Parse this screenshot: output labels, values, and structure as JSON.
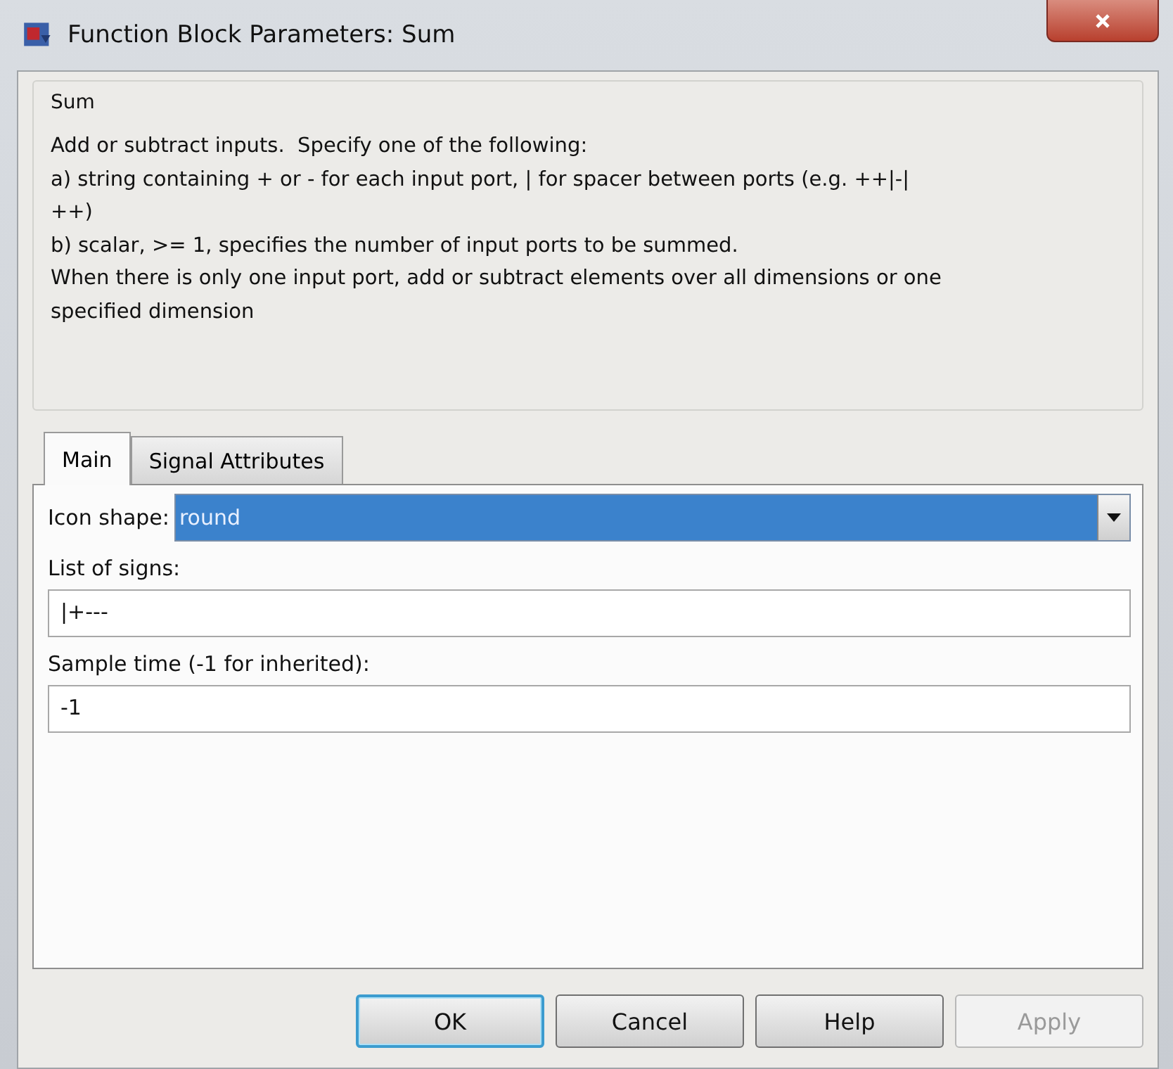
{
  "window": {
    "title": "Function Block Parameters: Sum"
  },
  "group": {
    "title": "Sum",
    "description": [
      "Add or subtract inputs.  Specify one of the following:",
      "a) string containing + or - for each input port, | for spacer between ports (e.g. ++|-|",
      "++)",
      "b) scalar, >= 1, specifies the number of input ports to be summed.",
      "When there is only one input port, add or subtract elements over all dimensions or one",
      "specified dimension"
    ]
  },
  "tabs": [
    {
      "label": "Main",
      "selected": true
    },
    {
      "label": "Signal Attributes",
      "selected": false
    }
  ],
  "params": [
    {
      "kind": "dropdown",
      "label": "Icon shape:",
      "value": "round",
      "selected": true
    },
    {
      "kind": "text",
      "label": "List of signs:",
      "value": "|+---"
    },
    {
      "kind": "text",
      "label": "Sample time (-1 for inherited):",
      "value": "-1"
    }
  ],
  "buttons": [
    {
      "label": "OK",
      "default": true,
      "disabled": false
    },
    {
      "label": "Cancel",
      "default": false,
      "disabled": false
    },
    {
      "label": "Help",
      "default": false,
      "disabled": false
    },
    {
      "label": "Apply",
      "default": false,
      "disabled": true
    }
  ]
}
